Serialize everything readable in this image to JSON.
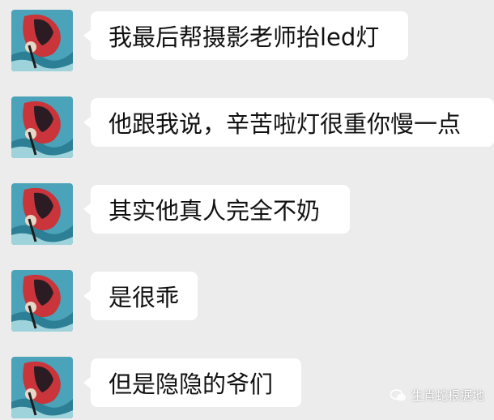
{
  "messages": [
    {
      "text": "我最后帮摄影老师抬led灯",
      "avatar_icon": "illustrated-avatar-icon"
    },
    {
      "text": "他跟我说，辛苦啦灯很重你慢一点",
      "avatar_icon": "illustrated-avatar-icon"
    },
    {
      "text": "其实他真人完全不奶",
      "avatar_icon": "illustrated-avatar-icon"
    },
    {
      "text": "是很乖",
      "avatar_icon": "illustrated-avatar-icon"
    },
    {
      "text": "但是隐隐的爷们",
      "avatar_icon": "illustrated-avatar-icon"
    }
  ],
  "watermark": {
    "text": "生肖蛇根据地",
    "icon": "wechat-public-account-icon"
  },
  "colors": {
    "background": "#ececec",
    "bubble": "#ffffff",
    "text": "#111111"
  }
}
